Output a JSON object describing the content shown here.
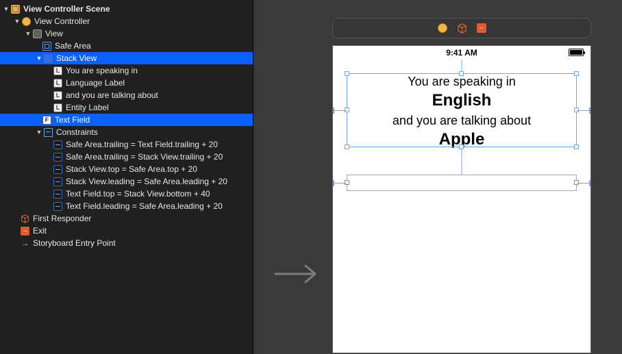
{
  "outline": {
    "scene": "View Controller Scene",
    "vc": "View Controller",
    "view": "View",
    "safeArea": "Safe Area",
    "stackView": "Stack View",
    "labels": [
      "You are speaking in",
      "Language Label",
      "and you are talking about",
      "Entity Label"
    ],
    "textField": "Text Field",
    "constraintsHeader": "Constraints",
    "constraints": [
      "Safe Area.trailing = Text Field.trailing + 20",
      "Safe Area.trailing = Stack View.trailing + 20",
      "Stack View.top = Safe Area.top + 20",
      "Stack View.leading = Safe Area.leading + 20",
      "Text Field.top = Stack View.bottom + 40",
      "Text Field.leading = Safe Area.leading + 20"
    ],
    "firstResponder": "First Responder",
    "exit": "Exit",
    "entry": "Storyboard Entry Point"
  },
  "device": {
    "time": "9:41 AM",
    "line1": "You are speaking in",
    "language": "English",
    "line2": "and you are talking about",
    "entity": "Apple"
  }
}
